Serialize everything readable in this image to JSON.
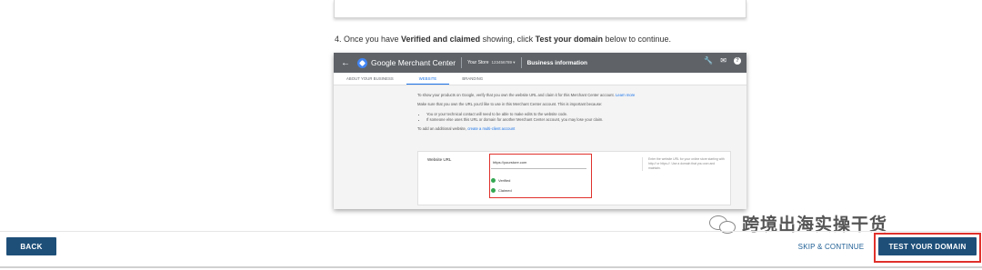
{
  "instruction": {
    "step": "4. Once you have ",
    "bold1": "Verified and claimed",
    "mid": " showing, click ",
    "bold2": "Test your domain",
    "end": " below to continue."
  },
  "gmc": {
    "app_name": "Google Merchant Center",
    "store_label": "Your Store",
    "store_id": "123456789 ▾",
    "page_title": "Business information",
    "tabs": [
      "ABOUT YOUR BUSINESS",
      "WEBSITE",
      "BRANDING"
    ],
    "active_tab": "WEBSITE",
    "intro": "To show your products on Google, verify that you own the website URL and claim it for this Merchant Center account.",
    "learn_more": "Learn more",
    "make_sure": "Make sure that you own the URL you'd like to use in this Merchant Center account. This is important because:",
    "bullets": [
      "You or your technical contact will need to be able to make edits to the website code.",
      "If someone else uses this URL or domain for another Merchant Center account, you may lose your claim."
    ],
    "additional": "To add an additional website,",
    "multi_client": "create a multi-client account",
    "website_url_label": "Website URL",
    "url_value": "https://yourstore.com",
    "verified": "Verified",
    "claimed": "Claimed",
    "help_text": "Enter the website URL for your online store starting with http:// or https://. Use a domain that you own and maintain."
  },
  "watermark": {
    "text": "跨境出海实操干货"
  },
  "footer": {
    "back_label": "BACK",
    "skip_label": "SKIP & CONTINUE",
    "test_label": "TEST YOUR DOMAIN"
  },
  "colors": {
    "primary_button": "#1e4f79",
    "highlight": "#e0312b",
    "link": "#1a73e8"
  }
}
